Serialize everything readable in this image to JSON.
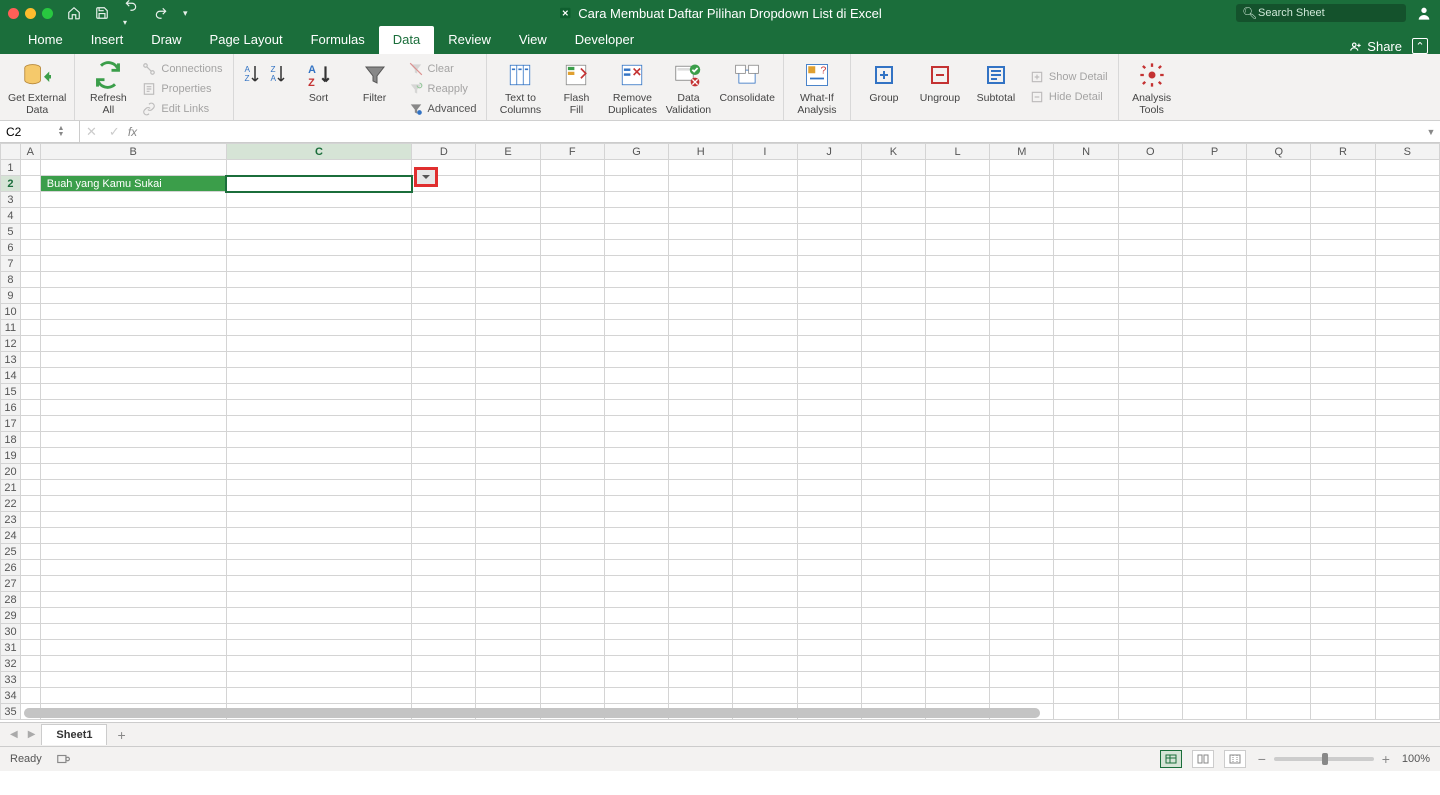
{
  "titlebar": {
    "doc_title": "Cara Membuat Daftar Pilihan Dropdown List di Excel",
    "search_placeholder": "Search Sheet"
  },
  "menu": {
    "tabs": [
      "Home",
      "Insert",
      "Draw",
      "Page Layout",
      "Formulas",
      "Data",
      "Review",
      "View",
      "Developer"
    ],
    "active_index": 5,
    "share": "Share"
  },
  "ribbon": {
    "get_external_data": "Get External\nData",
    "refresh_all": "Refresh\nAll",
    "connections": "Connections",
    "properties": "Properties",
    "edit_links": "Edit Links",
    "sort": "Sort",
    "filter": "Filter",
    "clear": "Clear",
    "reapply": "Reapply",
    "advanced": "Advanced",
    "text_to_columns": "Text to\nColumns",
    "flash_fill": "Flash\nFill",
    "remove_duplicates": "Remove\nDuplicates",
    "data_validation": "Data\nValidation",
    "consolidate": "Consolidate",
    "whatif": "What-If\nAnalysis",
    "group": "Group",
    "ungroup": "Ungroup",
    "subtotal": "Subtotal",
    "show_detail": "Show Detail",
    "hide_detail": "Hide Detail",
    "analysis_tools": "Analysis\nTools"
  },
  "formula_bar": {
    "cell_ref": "C2",
    "formula": ""
  },
  "grid": {
    "columns": [
      "A",
      "B",
      "C",
      "D",
      "E",
      "F",
      "G",
      "H",
      "I",
      "J",
      "K",
      "L",
      "M",
      "N",
      "O",
      "P",
      "Q",
      "R",
      "S"
    ],
    "row_count": 35,
    "active_col_index": 2,
    "active_row": 2,
    "b2_label": "Buah yang Kamu Sukai",
    "c2_value": ""
  },
  "sheet_tabs": {
    "sheets": [
      "Sheet1"
    ],
    "active": 0
  },
  "status": {
    "ready": "Ready",
    "zoom": "100%"
  }
}
